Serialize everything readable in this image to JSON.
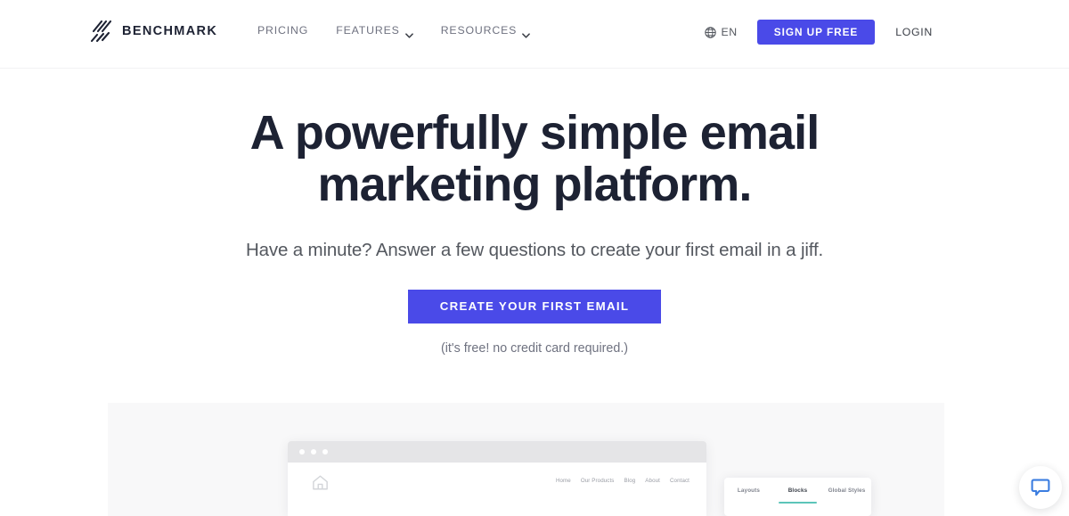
{
  "header": {
    "brand": {
      "name": "BENCHMARK",
      "logo_icon": "benchmark-slashes-logo"
    },
    "nav": [
      {
        "label": "PRICING",
        "has_dropdown": false
      },
      {
        "label": "FEATURES",
        "has_dropdown": true
      },
      {
        "label": "RESOURCES",
        "has_dropdown": true
      }
    ],
    "language": {
      "icon": "globe-icon",
      "label": "EN"
    },
    "signup_label": "SIGN UP FREE",
    "login_label": "LOGIN"
  },
  "hero": {
    "title_line1": "A powerfully simple email",
    "title_line2": "marketing platform.",
    "subtitle": "Have a minute? Answer a few questions to create your first email in a jiff.",
    "cta_label": "CREATE YOUR FIRST EMAIL",
    "cta_note": "(it's free! no credit card required.)"
  },
  "showcase": {
    "browser_mock": {
      "home_icon": "home-icon",
      "nav": [
        "Home",
        "Our Products",
        "Blog",
        "About",
        "Contact"
      ]
    },
    "editor_panel": {
      "tabs": [
        {
          "label": "Layouts",
          "active": false
        },
        {
          "label": "Blocks",
          "active": true
        },
        {
          "label": "Global Styles",
          "active": false
        }
      ]
    }
  },
  "chat": {
    "icon": "chat-bubble-icon"
  },
  "colors": {
    "accent_blue": "#4a4ae8",
    "heading_dark": "#1d2233",
    "body_gray": "#54585f",
    "nav_gray": "#6f7280",
    "panel_bg": "#f8f8f9",
    "tab_active_teal": "#5cc5b9",
    "chat_blue": "#3b7de0"
  }
}
